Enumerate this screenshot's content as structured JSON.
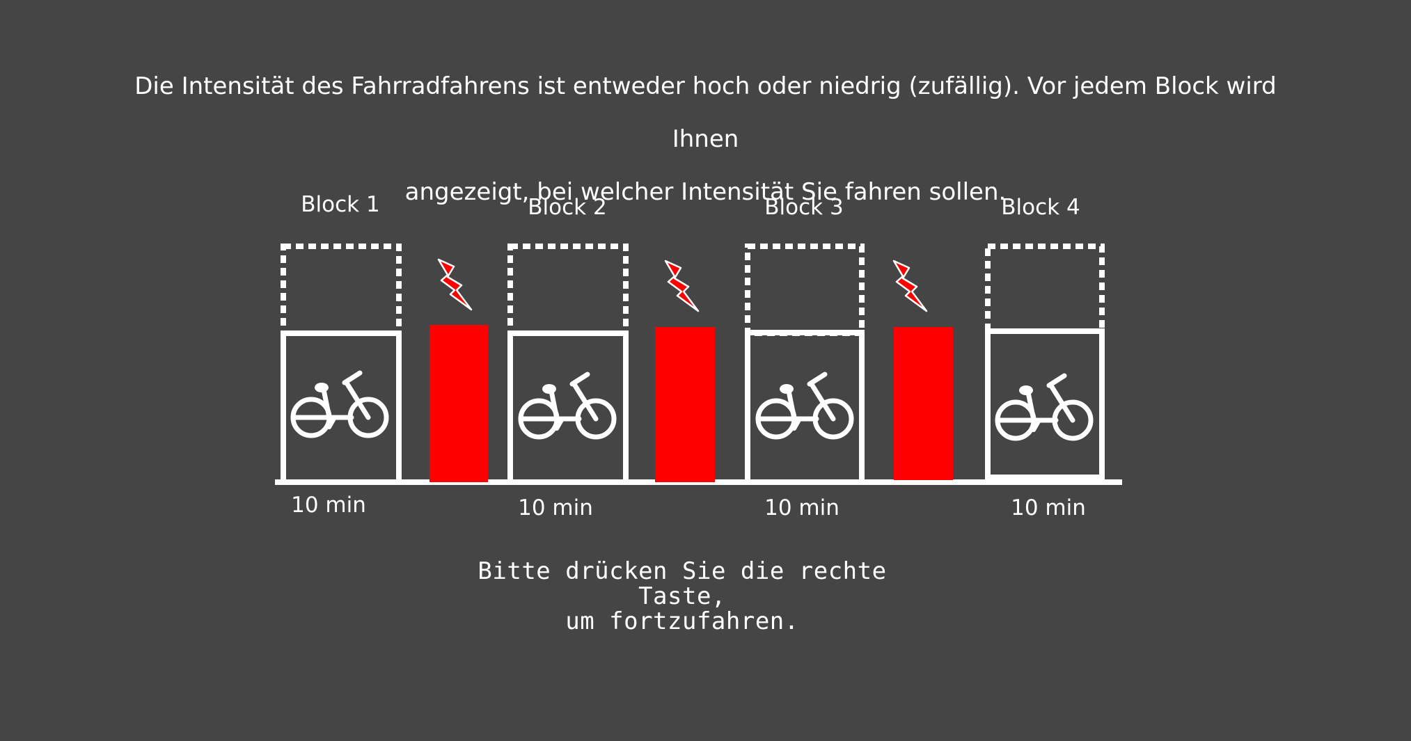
{
  "instruction": {
    "line1": "Die Intensität des Fahrradfahrens ist entweder hoch oder niedrig (zufällig). Vor jedem Block wird Ihnen",
    "line2": "angezeigt, bei welcher Intensität Sie fahren sollen."
  },
  "blocks": [
    {
      "label": "Block 1",
      "duration": "10 min",
      "icon": "bicycle-icon"
    },
    {
      "label": "Block 2",
      "duration": "10 min",
      "icon": "bicycle-icon"
    },
    {
      "label": "Block 3",
      "duration": "10 min",
      "icon": "bicycle-icon"
    },
    {
      "label": "Block 4",
      "duration": "10 min",
      "icon": "bicycle-icon"
    }
  ],
  "break_icon": "lightning-icon",
  "colors": {
    "background": "#454545",
    "foreground": "#ffffff",
    "break_bar": "#ff0000"
  },
  "continue_prompt": {
    "line1": "Bitte drücken Sie die rechte Taste,",
    "line2": "um fortzufahren."
  }
}
